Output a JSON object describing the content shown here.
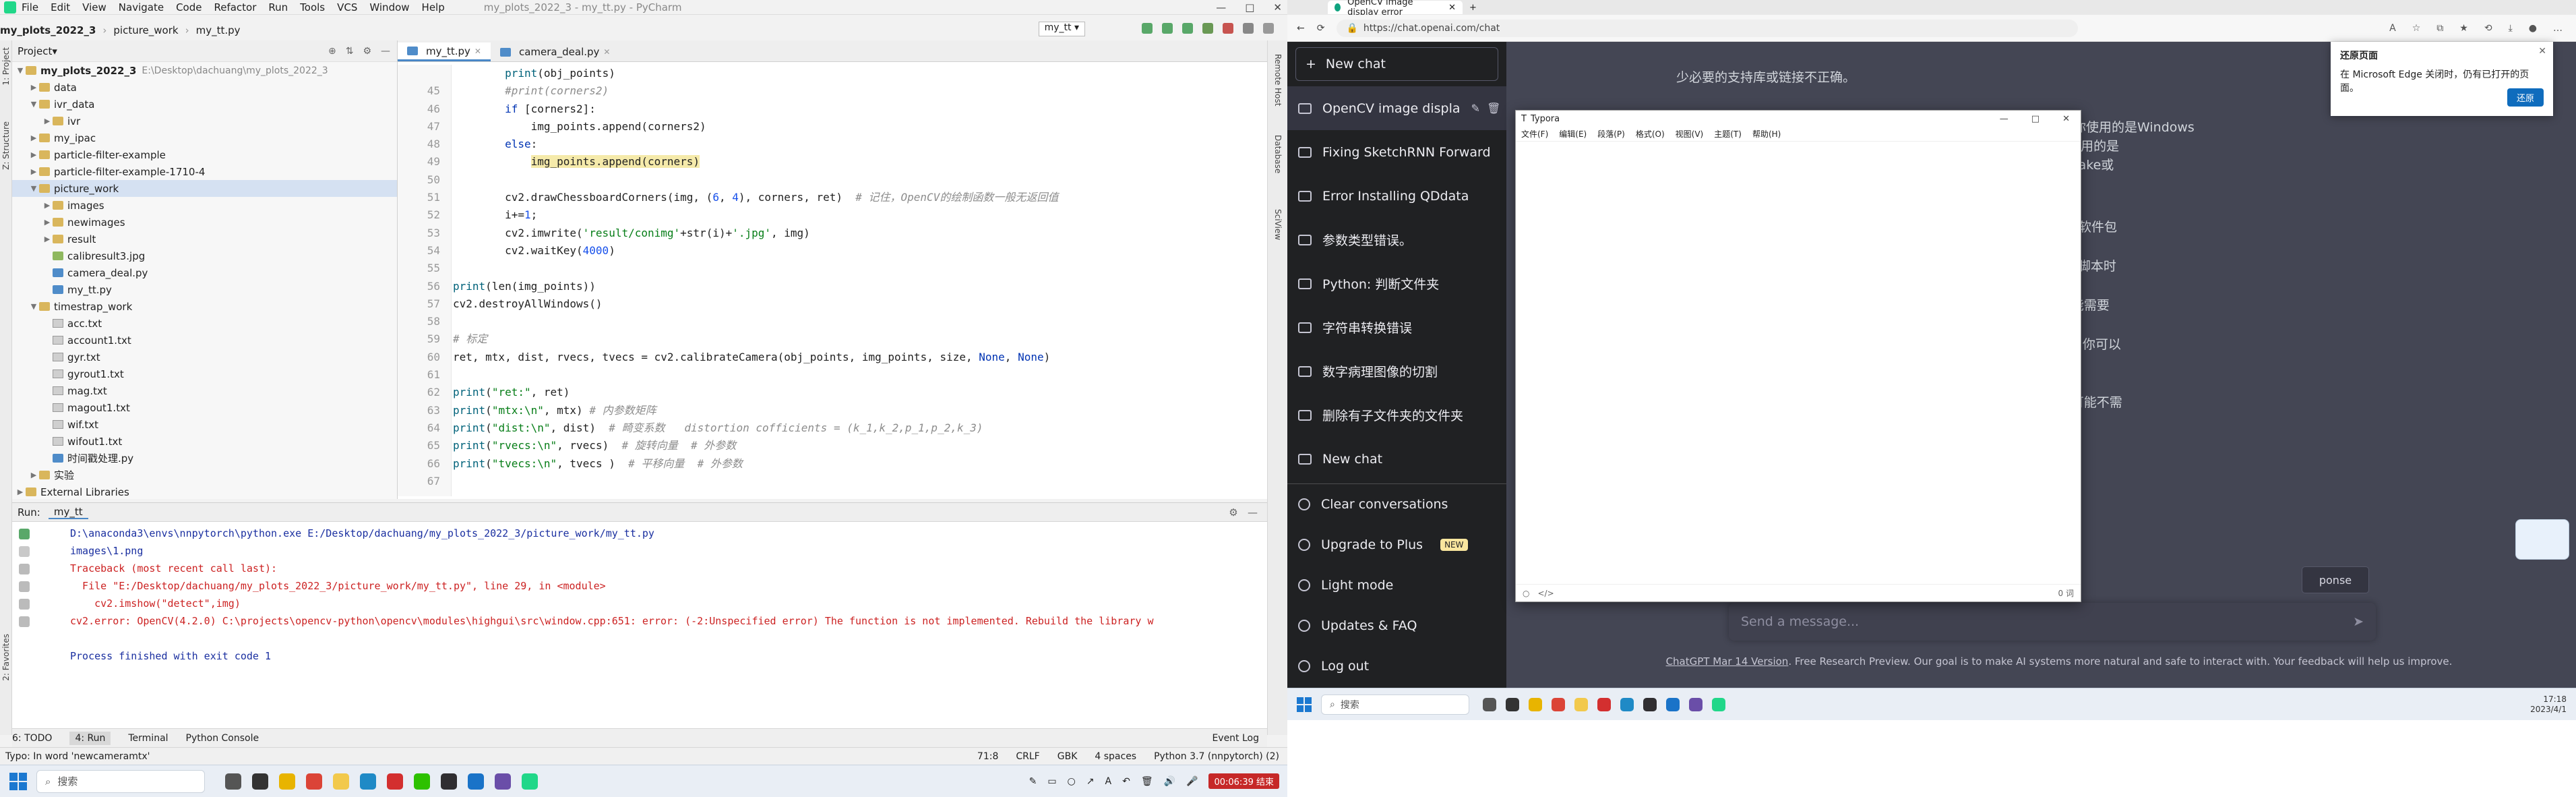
{
  "colors": {
    "pycharm_bg": "#f2f2f2",
    "editor_bg": "#ffffff",
    "keyword": "#0033b3",
    "string": "#067d17",
    "number": "#1750eb",
    "comment": "#8c8c8c",
    "error_text": "#c22222",
    "chatgpt_sidebar": "#202123",
    "chatgpt_main": "#444654",
    "edge_accent": "#0f6cbd"
  },
  "pycharm": {
    "menu": [
      "File",
      "Edit",
      "View",
      "Navigate",
      "Code",
      "Refactor",
      "Run",
      "Tools",
      "VCS",
      "Window",
      "Help"
    ],
    "window_title": "my_plots_2022_3 - my_tt.py - PyCharm",
    "breadcrumb": [
      "my_plots_2022_3",
      "picture_work",
      "my_tt.py"
    ],
    "run_config": "my_tt",
    "left_strip": [
      "1: Project",
      "Z: Structure",
      "2: Favorites"
    ],
    "right_strip": [
      "Remote Host",
      "Database",
      "SciView"
    ],
    "project_panel": {
      "title": "Project",
      "tree": [
        {
          "name": "my_plots_2022_3",
          "extra": "E:\\Desktop\\dachuang\\my_plots_2022_3",
          "type": "folder",
          "open": true,
          "level": 0,
          "bold": true
        },
        {
          "name": "data",
          "type": "folder",
          "level": 1
        },
        {
          "name": "ivr_data",
          "type": "folder",
          "open": true,
          "level": 1
        },
        {
          "name": "ivr",
          "type": "folder",
          "level": 2
        },
        {
          "name": "my_ipac",
          "type": "folder",
          "level": 1
        },
        {
          "name": "particle-filter-example",
          "type": "folder",
          "level": 1
        },
        {
          "name": "particle-filter-example-1710-4",
          "type": "folder",
          "level": 1
        },
        {
          "name": "picture_work",
          "type": "folder",
          "open": true,
          "level": 1,
          "selected": true
        },
        {
          "name": "images",
          "type": "folder",
          "level": 2
        },
        {
          "name": "newimages",
          "type": "folder",
          "level": 2
        },
        {
          "name": "result",
          "type": "folder",
          "level": 2
        },
        {
          "name": "calibresult3.jpg",
          "type": "image",
          "level": 2
        },
        {
          "name": "camera_deal.py",
          "type": "py",
          "level": 2
        },
        {
          "name": "my_tt.py",
          "type": "py",
          "level": 2
        },
        {
          "name": "timestrap_work",
          "type": "folder",
          "open": true,
          "level": 1
        },
        {
          "name": "acc.txt",
          "type": "file",
          "level": 2
        },
        {
          "name": "account1.txt",
          "type": "file",
          "level": 2
        },
        {
          "name": "gyr.txt",
          "type": "file",
          "level": 2
        },
        {
          "name": "gyrout1.txt",
          "type": "file",
          "level": 2
        },
        {
          "name": "mag.txt",
          "type": "file",
          "level": 2
        },
        {
          "name": "magout1.txt",
          "type": "file",
          "level": 2
        },
        {
          "name": "wif.txt",
          "type": "file",
          "level": 2
        },
        {
          "name": "wifout1.txt",
          "type": "file",
          "level": 2
        },
        {
          "name": "时间戳处理.py",
          "type": "py",
          "level": 2
        },
        {
          "name": "实验",
          "type": "folder",
          "level": 1
        },
        {
          "name": "External Libraries",
          "type": "folder",
          "level": 0
        }
      ]
    },
    "editor_tabs": [
      "my_tt.py",
      "camera_deal.py"
    ],
    "code_lines": [
      {
        "n": "",
        "html": "        <span class='fn'>print</span>(obj_points)"
      },
      {
        "n": "45",
        "html": "        <span class='cm'>#print(corners2)</span>"
      },
      {
        "n": "46",
        "html": "        <span class='kw'>if</span> [corners2]:"
      },
      {
        "n": "47",
        "html": "            img_points.append(corners2)"
      },
      {
        "n": "48",
        "html": "        <span class='kw'>else</span>:"
      },
      {
        "n": "49",
        "html": "            <span class='hl'>img_points.append(corners)</span>"
      },
      {
        "n": "50",
        "html": ""
      },
      {
        "n": "51",
        "html": "        cv2.drawChessboardCorners(img, (<span class='num'>6</span>, <span class='num'>4</span>), corners, ret)  <span class='cm'># 记住，OpenCV的绘制函数一般无返回值</span>"
      },
      {
        "n": "52",
        "html": "        i+=<span class='num'>1</span>;"
      },
      {
        "n": "53",
        "html": "        cv2.imwrite(<span class='str'>'result/conimg'</span>+str(i)+<span class='str'>'.jpg'</span>, img)"
      },
      {
        "n": "54",
        "html": "        cv2.waitKey(<span class='num'>4000</span>)"
      },
      {
        "n": "55",
        "html": ""
      },
      {
        "n": "56",
        "html": "<span class='fn'>print</span>(len(img_points))"
      },
      {
        "n": "57",
        "html": "cv2.destroyAllWindows()"
      },
      {
        "n": "58",
        "html": ""
      },
      {
        "n": "59",
        "html": "<span class='cm'># 标定</span>"
      },
      {
        "n": "60",
        "html": "ret, mtx, dist, rvecs, tvecs = cv2.calibrateCamera(obj_points, img_points, size, <span class='kw'>None</span>, <span class='kw'>None</span>)"
      },
      {
        "n": "61",
        "html": ""
      },
      {
        "n": "62",
        "html": "<span class='fn'>print</span>(<span class='str'>\"ret:\"</span>, ret)"
      },
      {
        "n": "63",
        "html": "<span class='fn'>print</span>(<span class='str'>\"mtx:\\n\"</span>, mtx) <span class='cm'># 内参数矩阵</span>"
      },
      {
        "n": "64",
        "html": "<span class='fn'>print</span>(<span class='str'>\"dist:\\n\"</span>, dist)  <span class='cm'># 畸变系数   distortion cofficients = (k_1,k_2,p_1,p_2,k_3)</span>"
      },
      {
        "n": "65",
        "html": "<span class='fn'>print</span>(<span class='str'>\"rvecs:\\n\"</span>, rvecs)  <span class='cm'># 旋转向量  # 外参数</span>"
      },
      {
        "n": "66",
        "html": "<span class='fn'>print</span>(<span class='str'>\"tvecs:\\n\"</span>, tvecs )  <span class='cm'># 平移向量  # 外参数</span>"
      },
      {
        "n": "67",
        "html": ""
      }
    ],
    "run_label": "Run:",
    "run_tab": "my_tt",
    "console": [
      {
        "cls": "blue",
        "text": "D:\\anaconda3\\envs\\nnpytorch\\python.exe E:/Desktop/dachuang/my_plots_2022_3/picture_work/my_tt.py"
      },
      {
        "cls": "blue",
        "text": "images\\1.png"
      },
      {
        "cls": "err",
        "text": "Traceback (most recent call last):"
      },
      {
        "cls": "err",
        "text": "  File \"E:/Desktop/dachuang/my_plots_2022_3/picture_work/my_tt.py\", line 29, in <module>"
      },
      {
        "cls": "err",
        "text": "    cv2.imshow(\"detect\",img)"
      },
      {
        "cls": "err",
        "text": "cv2.error: OpenCV(4.2.0) C:\\projects\\opencv-python\\opencv\\modules\\highgui\\src\\window.cpp:651: error: (-2:Unspecified error) The function is not implemented. Rebuild the library w"
      },
      {
        "cls": "",
        "text": ""
      },
      {
        "cls": "blue",
        "text": "Process finished with exit code 1"
      }
    ],
    "tool_windows": [
      "6: TODO",
      "4: Run",
      "Terminal",
      "Python Console"
    ],
    "event_log": "Event Log",
    "status_left": "Typo: In word 'newcameramtx'",
    "status_right": [
      "71:8",
      "CRLF",
      "GBK",
      "4 spaces",
      "Python 3.7 (nnpytorch) (2)"
    ],
    "taskbar_search": "搜索",
    "recording": "00:06:39 结束"
  },
  "edge": {
    "tab_title": "OpenCV image display error",
    "url": "https://chat.openai.com/chat",
    "popup_title": "还原页面",
    "popup_text": "在 Microsoft Edge 关闭时，仍有已打开的页面。",
    "popup_button": "还原"
  },
  "chatgpt": {
    "new_chat": "New chat",
    "conversations": [
      "OpenCV image displa",
      "Fixing SketchRNN Forward",
      "Error Installing QDdata",
      "参数类型错误。",
      "Python: 判断文件夹",
      "字符串转换错误",
      "数字病理图像的切割",
      "删除有子文件夹的文件夹",
      "New chat"
    ],
    "bottom": [
      {
        "label": "Clear conversations",
        "icon": "trash-icon"
      },
      {
        "label": "Upgrade to Plus",
        "icon": "user-icon",
        "badge": "NEW"
      },
      {
        "label": "Light mode",
        "icon": "sun-icon"
      },
      {
        "label": "Updates & FAQ",
        "icon": "external-link-icon"
      },
      {
        "label": "Log out",
        "icon": "logout-icon"
      }
    ],
    "answer_lines": [
      "少必要的支持库或链接不正确。",
      "错误信息提示你可能缺少某些操作系统或窗口系统的必要支持库。如果你使用的是Windows",
      "ndows支持所需的库。如果你使用的是",
      "onfig开发包，然后重新运行cmake或",
      "阅OpenCV文档中所列出的所需软件包",
      "期检查运行cmake或configure脚本时",
      "听需的Windows支持库。你可能需要",
      "(+ 2.x库和pkg-config开发包。你可以",
      "否仅限于你的设置。",
      "如matplotlib或PyQt，这些库可能不需"
    ],
    "regenerate": "ponse",
    "message_placeholder": "Send a message...",
    "footer_link": "ChatGPT Mar 14 Version",
    "footer_text": ". Free Research Preview. Our goal is to make AI systems more natural and safe to interact with. Your feedback will help us improve."
  },
  "typora": {
    "title": "Typora",
    "menu": [
      "文件(F)",
      "编辑(E)",
      "段落(P)",
      "格式(O)",
      "视图(V)",
      "主题(T)",
      "帮助(H)"
    ],
    "word_count": "0 词"
  },
  "taskbar2": {
    "search": "搜索",
    "time": "17:18",
    "date": "2023/4/1"
  }
}
